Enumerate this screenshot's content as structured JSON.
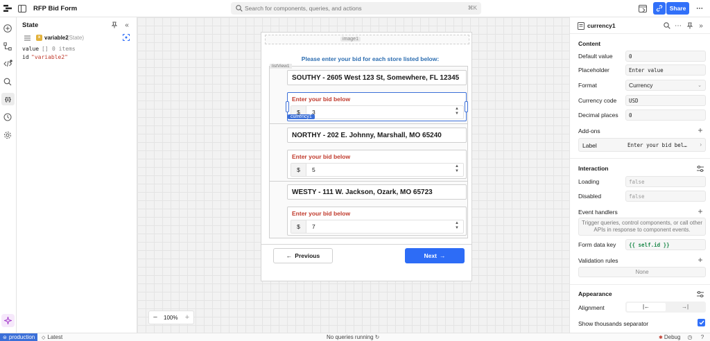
{
  "app": {
    "title": "RFP Bid Form"
  },
  "search": {
    "placeholder": "Search for components, queries, and actions",
    "shortcut": "⌘K"
  },
  "toolbar": {
    "share_label": "Share"
  },
  "state_panel": {
    "title": "State",
    "variable_name": "variable2",
    "variable_tag": "(State)",
    "value_key": "value",
    "value_brackets": "[]",
    "value_count": "0 items",
    "id_key": "id",
    "id_value": "\"variable2\""
  },
  "canvas": {
    "image_tag": "image1",
    "heading": "Please enter your bid for each store listed below:",
    "list_tag": "listView1",
    "selected_tag": "currency1",
    "stores": [
      {
        "name": "SOUTHY - 2605 West 123 St, Somewhere, FL 12345",
        "bid_label": "Enter your bid below",
        "currency_symbol": "$",
        "bid_value": "3"
      },
      {
        "name": "NORTHY - 202 E. Johnny, Marshall, MO 65240",
        "bid_label": "Enter your bid below",
        "currency_symbol": "$",
        "bid_value": "5"
      },
      {
        "name": "WESTY - 111 W. Jackson, Ozark, MO 65723",
        "bid_label": "Enter your bid below",
        "currency_symbol": "$",
        "bid_value": "7"
      }
    ],
    "prev_label": "Previous",
    "next_label": "Next",
    "zoom": "100%"
  },
  "inspector": {
    "component": "currency1",
    "content_section": "Content",
    "default_value_label": "Default value",
    "default_value": "0",
    "placeholder_label": "Placeholder",
    "placeholder_value": "Enter value",
    "format_label": "Format",
    "format_value": "Currency",
    "currency_code_label": "Currency code",
    "currency_code": "USD",
    "decimal_places_label": "Decimal places",
    "decimal_places": "0",
    "addons_label": "Add-ons",
    "addon_label_key": "Label",
    "addon_label_value": "Enter your bid bel…",
    "interaction_section": "Interaction",
    "loading_label": "Loading",
    "loading_value": "false",
    "disabled_label": "Disabled",
    "disabled_value": "false",
    "event_handlers_label": "Event handlers",
    "event_handlers_hint": "Trigger queries, control components, or call other APIs in response to component events.",
    "form_key_label": "Form data key",
    "form_key_value": "{{ self.id }}",
    "validation_label": "Validation rules",
    "validation_value": "None",
    "appearance_section": "Appearance",
    "alignment_label": "Alignment",
    "alignment_left": "|←",
    "alignment_right": "→|",
    "thousands_label": "Show thousands separator",
    "thousands_checked": true
  },
  "status": {
    "env": "production",
    "version": "Latest",
    "queries": "No queries running",
    "debug": "Debug"
  },
  "colors": {
    "accent": "#3170f9",
    "primary_button": "#2d6cf6",
    "bid_label": "#c0392b",
    "heading": "#2b6cb0",
    "badge": "#3b6fd8"
  }
}
